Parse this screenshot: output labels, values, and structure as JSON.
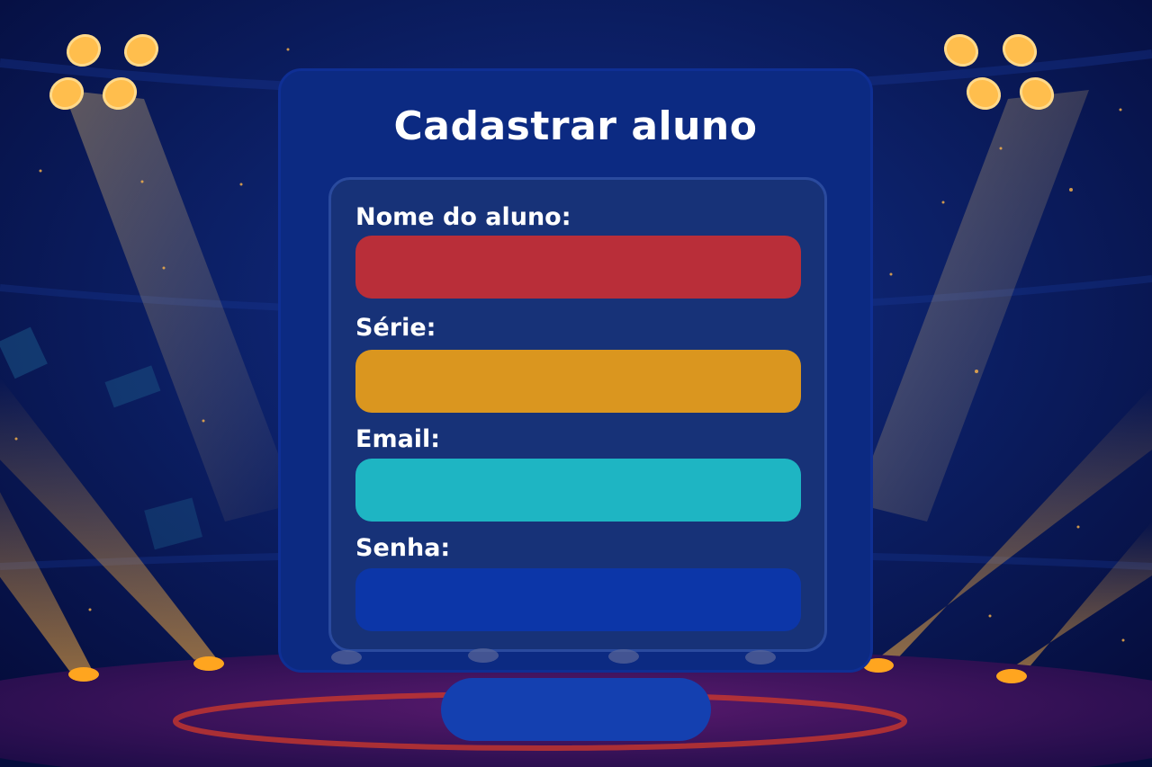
{
  "form": {
    "title": "Cadastrar aluno",
    "fields": [
      {
        "label": "Nome do aluno:",
        "value": "",
        "color": "#b92e39"
      },
      {
        "label": "Série:",
        "value": "",
        "color": "#da961f"
      },
      {
        "label": "Email:",
        "value": "",
        "color": "#1eb5c3"
      },
      {
        "label": "Senha:",
        "value": "",
        "color": "#0c36a8"
      }
    ],
    "submit_label": ""
  },
  "colors": {
    "background": "#07154f",
    "card": "#0c2a82",
    "panel": "#173278",
    "spotlight": "#ffc04d",
    "stage_ring": "#d23a2a"
  }
}
